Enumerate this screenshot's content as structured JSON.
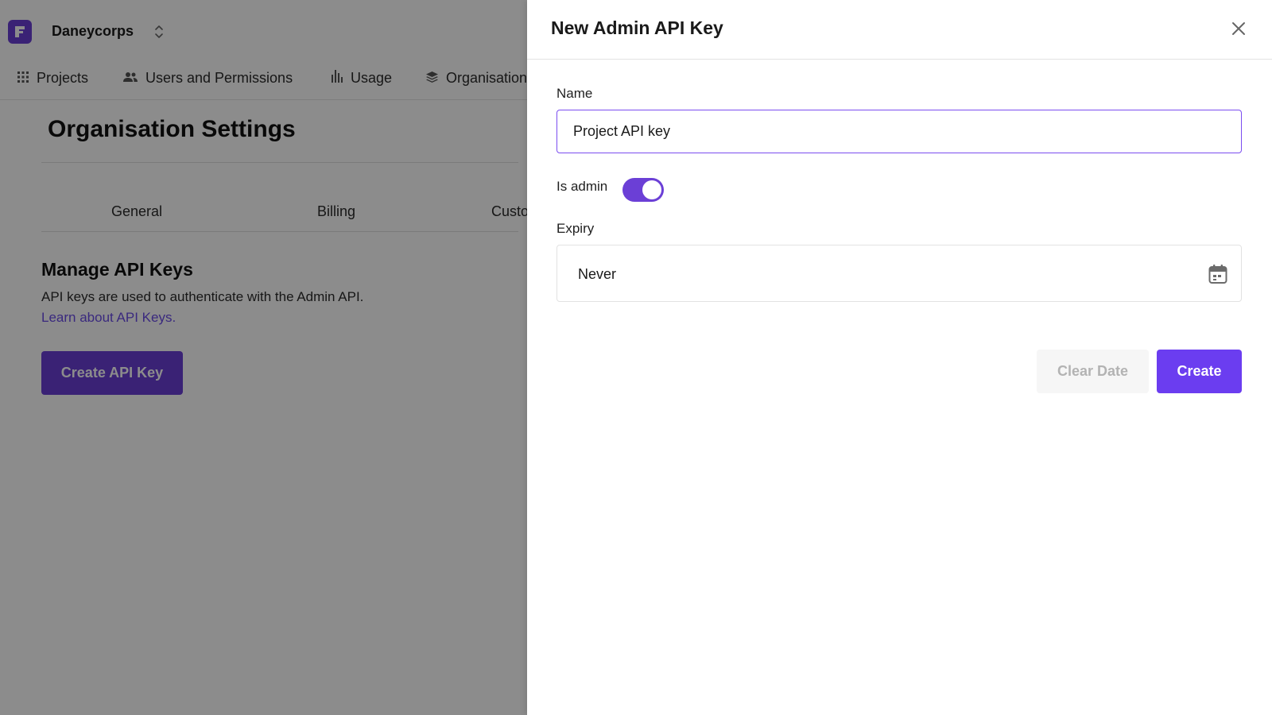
{
  "colors": {
    "accent": "#6b3fd6",
    "link": "#6a4ce6",
    "primary_button": "#6b3df0",
    "overlay": "rgba(0,0,0,0.45)"
  },
  "header": {
    "org_name": "Daneycorps",
    "logo_icon": "brand-logo-icon",
    "switcher_icon": "chevron-up-down-icon"
  },
  "nav": {
    "items": [
      {
        "label": "Projects",
        "icon": "grid-icon"
      },
      {
        "label": "Users and Permissions",
        "icon": "users-icon"
      },
      {
        "label": "Usage",
        "icon": "bar-chart-icon"
      },
      {
        "label": "Organisation",
        "icon": "layers-icon"
      }
    ]
  },
  "page": {
    "title": "Organisation Settings",
    "tabs": [
      "General",
      "Billing",
      "Custo"
    ],
    "section_heading": "Manage API Keys",
    "section_description": "API keys are used to authenticate with the Admin API.",
    "learn_link": "Learn about API Keys.",
    "create_button": "Create API Key"
  },
  "drawer": {
    "title": "New Admin API Key",
    "close_icon": "close-icon",
    "name_label": "Name",
    "name_value": "Project API key",
    "is_admin_label": "Is admin",
    "is_admin": true,
    "expiry_label": "Expiry",
    "expiry_value": "Never",
    "calendar_icon": "calendar-icon",
    "clear_date_button": "Clear Date",
    "create_button": "Create"
  }
}
